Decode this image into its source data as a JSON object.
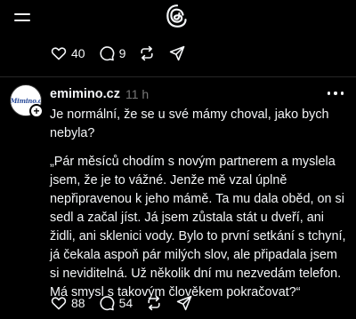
{
  "top_bar": {
    "menu_icon": "menu-icon",
    "logo_icon": "threads-logo-icon"
  },
  "previous_post_actions": {
    "like_count": "40",
    "comment_count": "9",
    "icons": [
      "heart-icon",
      "comment-icon",
      "repost-icon",
      "share-icon"
    ]
  },
  "post": {
    "avatar_text": "eMimino.cz",
    "username": "emimino.cz",
    "timestamp": "11 h",
    "intro": "Je normální, že se u své mámy choval, jako bych nebyla?",
    "quote": "„Pár měsíců chodím s novým partnerem a myslela jsem, že je to vážné. Jenže mě vzal úplně nepřipravenou k jeho mámě. Ta mu dala oběd, on si sedl a začal jíst. Já jsem zůstala stát u dveří, ani židli, ani sklenici vody. Bylo to první setkání s tchyní, já čekala aspoň pár milých slov, ale připadala jsem si neviditelná. Už několik dní mu nezvedám telefon. Má smysl s takovým člověkem pokračovat?“",
    "like_count": "88",
    "comment_count": "54"
  },
  "colors": {
    "background": "#000000",
    "text": "#f3f5f7",
    "secondary_text": "#777777",
    "divider": "#262626"
  }
}
